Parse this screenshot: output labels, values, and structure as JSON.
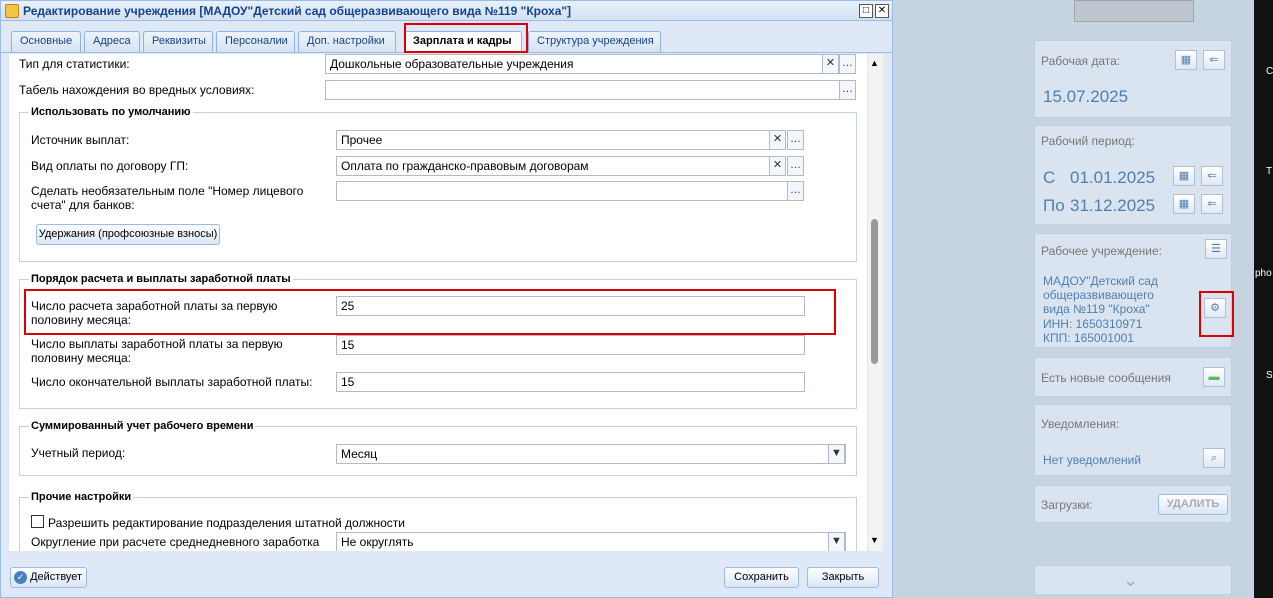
{
  "dialog": {
    "title": "Редактирование учреждения [МАДОУ\"Детский сад общеразвивающего вида №119 \"Кроха\"]",
    "tabs": [
      "Основные",
      "Адреса",
      "Реквизиты",
      "Персоналии",
      "Доп. настройки",
      "Зарплата и кадры",
      "Структура учреждения"
    ],
    "active_tab": "Зарплата и кадры"
  },
  "fields": {
    "stat_type_label": "Тип для статистики:",
    "stat_type_value": "Дошкольные образовательные учреждения",
    "tabel_label": "Табель нахождения во вредных условиях:",
    "tabel_value": "",
    "defaults_title": "Использовать по умолчанию",
    "source_label": "Источник выплат:",
    "source_value": "Прочее",
    "gp_label": "Вид оплаты по договору ГП:",
    "gp_value": "Оплата по гражданско-правовым договорам",
    "account_label": "Сделать необязательным поле \"Номер лицевого счета\" для банков:",
    "account_value": "",
    "deductions_button": "Удержания (профсоюзные взносы)",
    "salary_title": "Порядок расчета и выплаты заработной платы",
    "calc_first_label": "Число расчета заработной платы за первую половину месяца:",
    "calc_first_value": "25",
    "pay_first_label": "Число выплаты заработной платы за первую половину месяца:",
    "pay_first_value": "15",
    "final_pay_label": "Число окончательной выплаты заработной платы:",
    "final_pay_value": "15",
    "summed_title": "Суммированный учет рабочего времени",
    "period_label": "Учетный период:",
    "period_value": "Месяц",
    "other_title": "Прочие настройки",
    "allow_edit_label": "Разрешить редактирование подразделения штатной должности",
    "rounding_label": "Округление при расчете среднедневного заработка",
    "rounding_value": "Не округлять"
  },
  "bottom": {
    "status_button": "Действует",
    "save_button": "Сохранить",
    "close_button": "Закрыть"
  },
  "panel": {
    "work_date_label": "Рабочая дата:",
    "work_date": "15.07.2025",
    "work_period_label": "Рабочий период:",
    "from_prefix": "С",
    "from_date": "01.01.2025",
    "to_prefix": "По",
    "to_date": "31.12.2025",
    "org_label": "Рабочее учреждение:",
    "org_name": "МАДОУ\"Детский сад общеразвивающего вида №119 \"Кроха\"",
    "inn": "ИНН: 1650310971",
    "kpp": "КПП: 165001001",
    "messages_label": "Есть новые сообщения",
    "notifications_label": "Уведомления:",
    "notifications_value": "Нет уведомлений",
    "downloads_label": "Загрузки:",
    "delete_button": "УДАЛИТЬ"
  },
  "edge_text": {
    "a": "С",
    "b": "Т",
    "c": "pho",
    "d": "S"
  }
}
